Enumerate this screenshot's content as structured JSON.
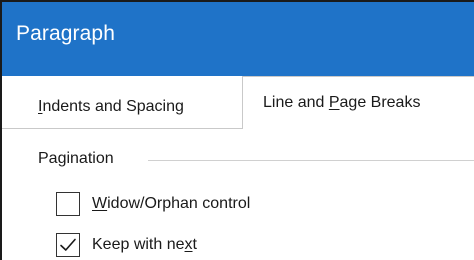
{
  "dialog": {
    "title": "Paragraph"
  },
  "tabs": [
    {
      "label_pre": "",
      "mnemonic": "I",
      "label_post": "ndents and Spacing",
      "selected": false
    },
    {
      "label_pre": "Line and ",
      "mnemonic": "P",
      "label_post": "age Breaks",
      "selected": true
    }
  ],
  "pagination": {
    "group_label": "Pagination",
    "options": [
      {
        "label_pre": "",
        "mnemonic": "W",
        "label_post": "idow/Orphan control",
        "checked": false
      },
      {
        "label_pre": "Keep with ne",
        "mnemonic": "x",
        "label_post": "t",
        "checked": true
      }
    ]
  },
  "icons": {
    "checkmark": "checkmark-icon"
  },
  "colors": {
    "titlebar": "#1f73c8",
    "title_text": "#ffffff",
    "text": "#1a1a1a",
    "divider": "#c9c9c9"
  }
}
